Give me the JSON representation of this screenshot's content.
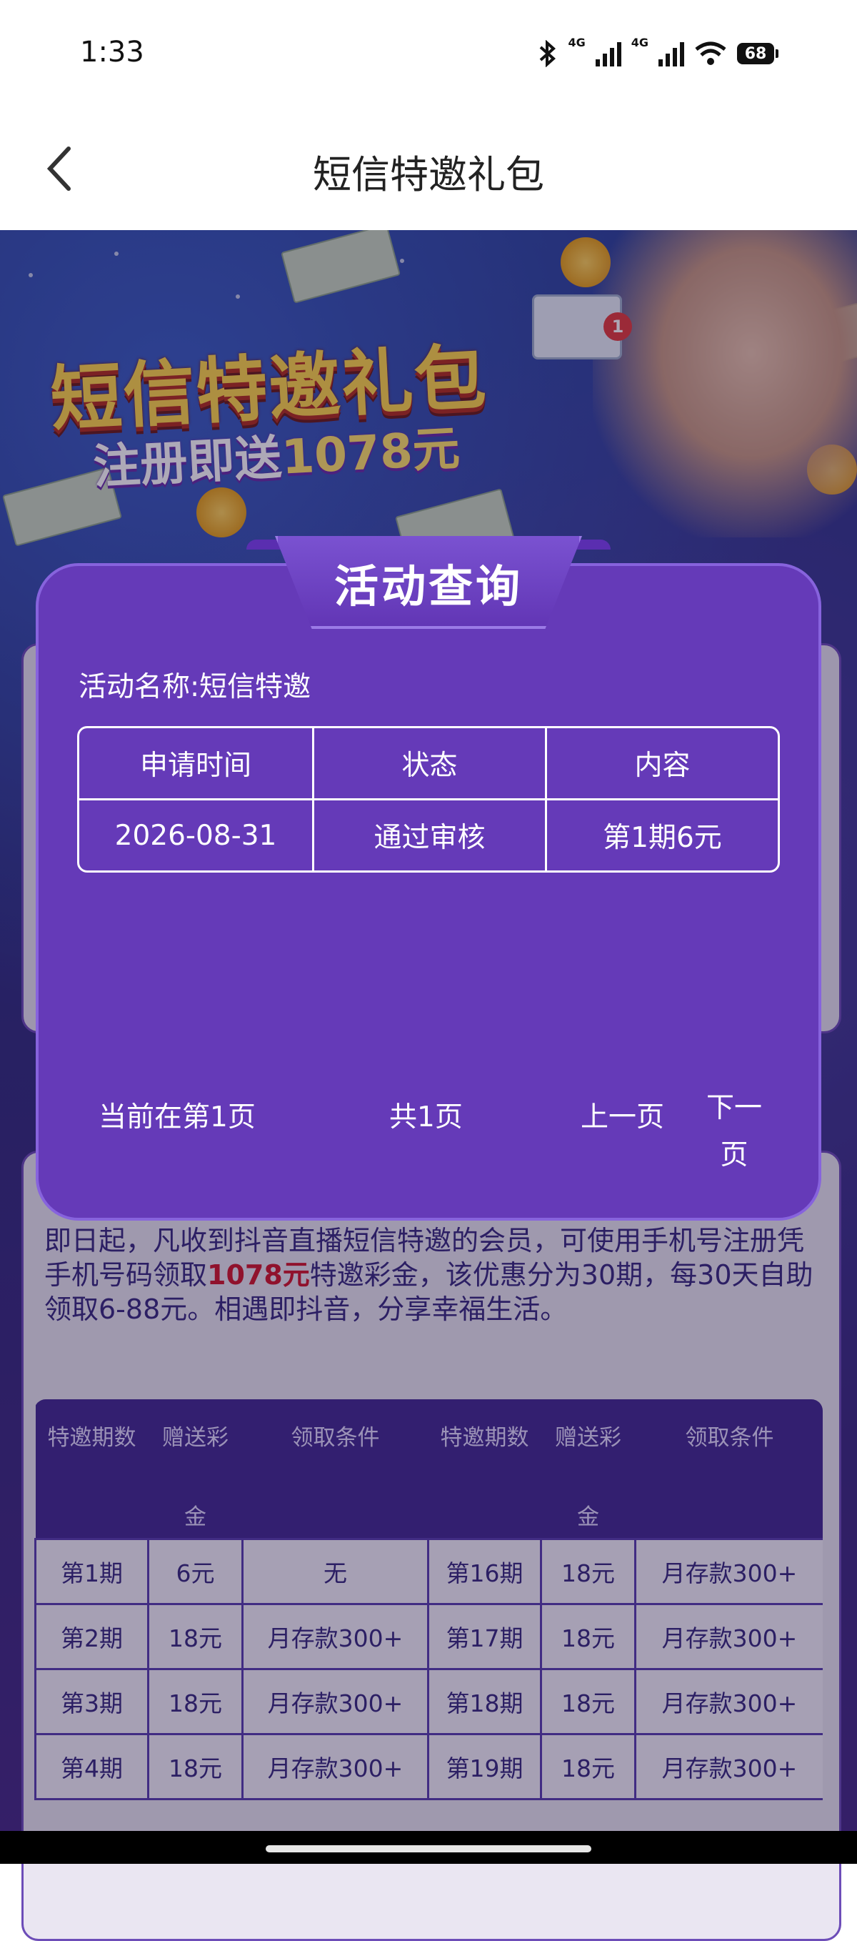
{
  "status_bar": {
    "time": "1:33",
    "network_1": "4G",
    "network_2": "4G",
    "battery": "68",
    "icons": [
      "bluetooth-icon",
      "signal-icon",
      "signal-icon",
      "wifi-icon",
      "battery-icon"
    ]
  },
  "header": {
    "title": "短信特邀礼包",
    "back_icon": "chevron-left-icon"
  },
  "banner": {
    "title": "短信特邀礼包",
    "subtitle_prefix": "注册即送",
    "subtitle_amount": "1078元",
    "badge": "1"
  },
  "modal": {
    "title": "活动查询",
    "activity_name": "活动名称:短信特邀",
    "table": {
      "headers": [
        "申请时间",
        "状态",
        "内容"
      ],
      "rows": [
        [
          "2026-08-31",
          "通过审核",
          "第1期6元"
        ]
      ]
    },
    "pager": {
      "current": "当前在第1页",
      "total": "共1页",
      "prev": "上一页",
      "next": "下一页"
    }
  },
  "intro": {
    "text_1": "即日起，凡收到抖音直播短信特邀的会员，可使用手机号注册凭手机号码领取",
    "amount": "1078元",
    "text_2": "特邀彩金，该优惠分为30期，每30天自助领取6-88元。相遇即抖音，分享幸福生活。"
  },
  "reward_table": {
    "headers": [
      "特邀期数",
      "赠送彩",
      "领取条件",
      "特邀期数",
      "赠送彩",
      "领取条件"
    ],
    "headers_line2": [
      "",
      "金",
      "",
      "",
      "金",
      ""
    ],
    "rows": [
      [
        "第1期",
        "6元",
        "无",
        "第16期",
        "18元",
        "月存款300+"
      ],
      [
        "第2期",
        "18元",
        "月存款300+",
        "第17期",
        "18元",
        "月存款300+"
      ],
      [
        "第3期",
        "18元",
        "月存款300+",
        "第18期",
        "18元",
        "月存款300+"
      ],
      [
        "第4期",
        "18元",
        "月存款300+",
        "第19期",
        "18元",
        "月存款300+"
      ]
    ]
  },
  "colors": {
    "modal_bg": "#653ab8",
    "accent_red": "#d3182b",
    "table_header_bg": "#442c92",
    "text_purple": "#3a2c80"
  }
}
